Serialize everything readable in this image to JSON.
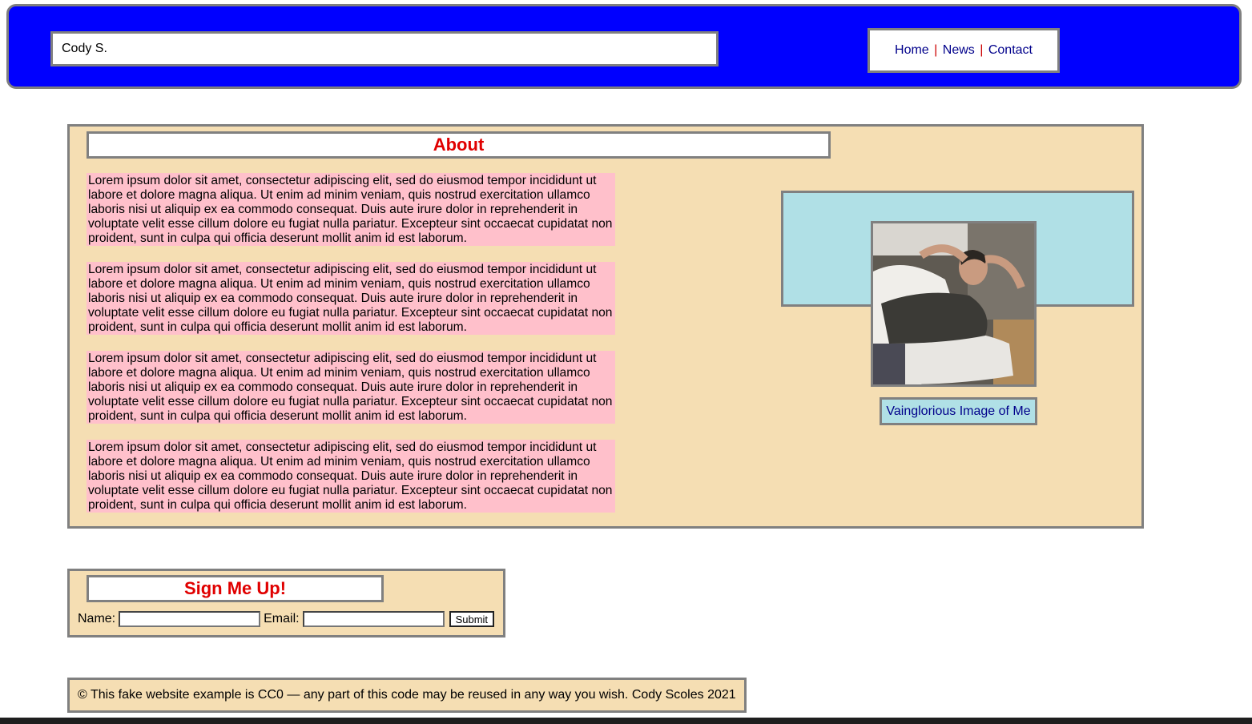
{
  "header": {
    "site_name": "Cody S.",
    "nav": {
      "home": "Home",
      "news": "News",
      "contact": "Contact",
      "separator": "|"
    }
  },
  "about": {
    "title": "About",
    "paragraphs": [
      "Lorem ipsum dolor sit amet, consectetur adipiscing elit, sed do eiusmod tempor incididunt ut labore et dolore magna aliqua. Ut enim ad minim veniam, quis nostrud exercitation ullamco laboris nisi ut aliquip ex ea commodo consequat. Duis aute irure dolor in reprehenderit in voluptate velit esse cillum dolore eu fugiat nulla pariatur. Excepteur sint occaecat cupidatat non proident, sunt in culpa qui officia deserunt mollit anim id est laborum.",
      "Lorem ipsum dolor sit amet, consectetur adipiscing elit, sed do eiusmod tempor incididunt ut labore et dolore magna aliqua. Ut enim ad minim veniam, quis nostrud exercitation ullamco laboris nisi ut aliquip ex ea commodo consequat. Duis aute irure dolor in reprehenderit in voluptate velit esse cillum dolore eu fugiat nulla pariatur. Excepteur sint occaecat cupidatat non proident, sunt in culpa qui officia deserunt mollit anim id est laborum.",
      "Lorem ipsum dolor sit amet, consectetur adipiscing elit, sed do eiusmod tempor incididunt ut labore et dolore magna aliqua. Ut enim ad minim veniam, quis nostrud exercitation ullamco laboris nisi ut aliquip ex ea commodo consequat. Duis aute irure dolor in reprehenderit in voluptate velit esse cillum dolore eu fugiat nulla pariatur. Excepteur sint occaecat cupidatat non proident, sunt in culpa qui officia deserunt mollit anim id est laborum.",
      "Lorem ipsum dolor sit amet, consectetur adipiscing elit, sed do eiusmod tempor incididunt ut labore et dolore magna aliqua. Ut enim ad minim veniam, quis nostrud exercitation ullamco laboris nisi ut aliquip ex ea commodo consequat. Duis aute irure dolor in reprehenderit in voluptate velit esse cillum dolore eu fugiat nulla pariatur. Excepteur sint occaecat cupidatat non proident, sunt in culpa qui officia deserunt mollit anim id est laborum."
    ],
    "image_caption": "Vainglorious Image of Me"
  },
  "signup": {
    "title": "Sign Me Up!",
    "name_label": "Name:",
    "email_label": "Email:",
    "name_value": "",
    "email_value": "",
    "submit_label": "Submit"
  },
  "footer": {
    "text": "© This fake website example is CC0 — any part of this code may be reused in any way you wish. Cody Scoles 2021"
  },
  "colors": {
    "header_bg": "#0000ff",
    "section_bg": "#f5deb3",
    "paragraph_bg": "#ffc0cb",
    "photo_band_bg": "#b0e0e6",
    "heading_text": "#e00000",
    "link_text": "#00008b",
    "border": "#808080"
  }
}
